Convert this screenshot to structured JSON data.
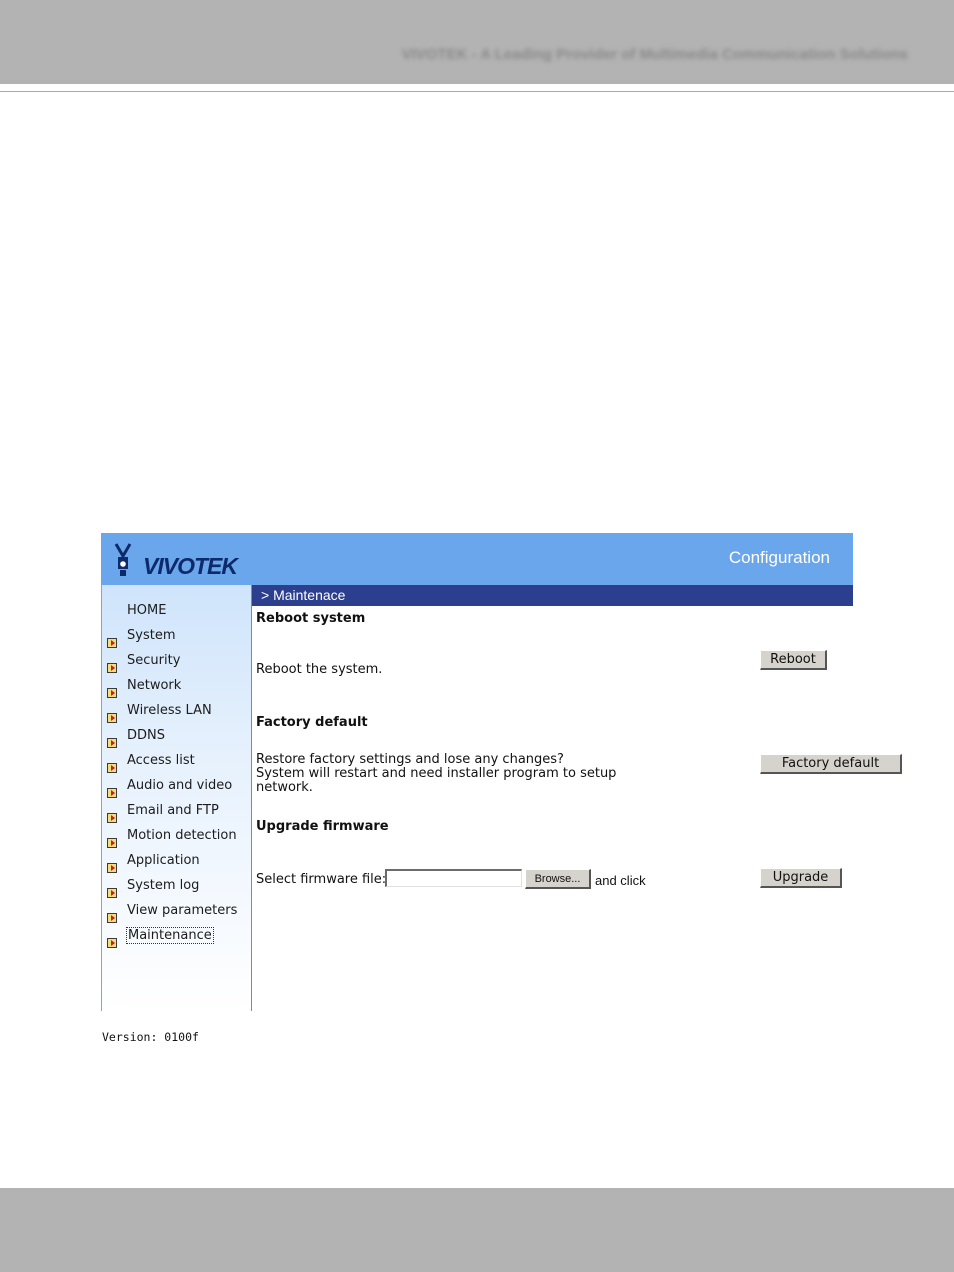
{
  "doc": {
    "header_text": "VIVOTEK - A Leading Provider of Multimedia Communication Solutions"
  },
  "app": {
    "logo_text": "VIVOTEK",
    "title": "Configuration"
  },
  "sidebar": {
    "items": [
      {
        "label": "HOME",
        "arrow": false
      },
      {
        "label": "System",
        "arrow": true
      },
      {
        "label": "Security",
        "arrow": true
      },
      {
        "label": "Network",
        "arrow": true
      },
      {
        "label": "Wireless LAN",
        "arrow": true
      },
      {
        "label": "DDNS",
        "arrow": true
      },
      {
        "label": "Access list",
        "arrow": true
      },
      {
        "label": "Audio and video",
        "arrow": true
      },
      {
        "label": "Email and FTP",
        "arrow": true
      },
      {
        "label": "Motion detection",
        "arrow": true
      },
      {
        "label": "Application",
        "arrow": true
      },
      {
        "label": "System log",
        "arrow": true
      },
      {
        "label": "View parameters",
        "arrow": true
      },
      {
        "label": "Maintenance",
        "arrow": true,
        "active": true
      }
    ],
    "version": "Version: 0100f"
  },
  "main": {
    "breadcrumb": "> Maintenace",
    "reboot": {
      "title": "Reboot system",
      "description": "Reboot the system.",
      "button": "Reboot"
    },
    "factory": {
      "title": "Factory default",
      "line1": "Restore factory settings and lose any changes?",
      "line2": "System will restart and need installer program to setup",
      "line3": "network.",
      "button": "Factory default"
    },
    "upgrade": {
      "title": "Upgrade firmware",
      "label": "Select firmware file:",
      "file_value": "",
      "browse_button": "Browse...",
      "and_click": "and click",
      "button": "Upgrade"
    }
  },
  "colors": {
    "header_blue": "#6aa6ec",
    "breadcrumb_navy": "#2b3f8e",
    "page_gray": "#b3b3b3"
  }
}
